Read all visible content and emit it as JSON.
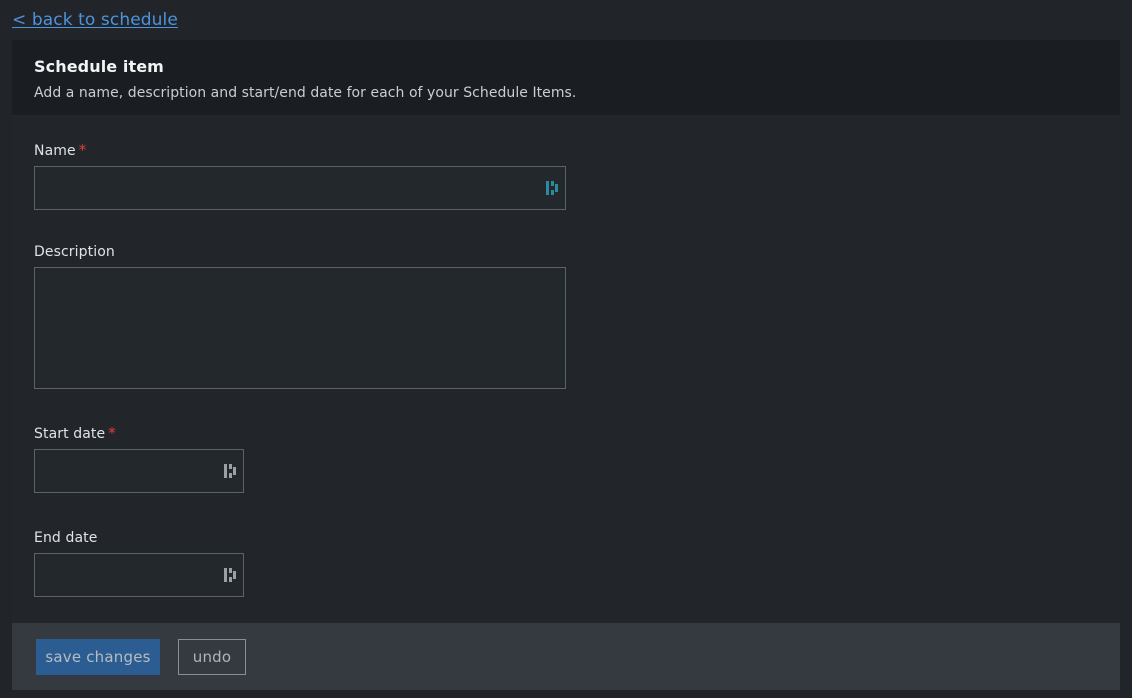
{
  "nav": {
    "back_link": "< back to schedule"
  },
  "card": {
    "title": "Schedule item",
    "subtitle": "Add a name, description and start/end date for each of your Schedule Items."
  },
  "form": {
    "name": {
      "label": "Name",
      "required_marker": "*",
      "value": "",
      "placeholder": ""
    },
    "description": {
      "label": "Description",
      "value": "",
      "placeholder": ""
    },
    "start_date": {
      "label": "Start date",
      "required_marker": "*",
      "value": "",
      "placeholder": ""
    },
    "end_date": {
      "label": "End date",
      "value": "",
      "placeholder": ""
    }
  },
  "footer": {
    "save_label": "save changes",
    "undo_label": "undo"
  },
  "colors": {
    "page_background": "#212529",
    "card_background": "#22262b",
    "header_background": "#1a1d21",
    "footer_background": "#343a40",
    "link": "#4d93dd",
    "required_asterisk": "#e03e3e",
    "primary_button": "#2b5d93",
    "input_border": "#5b6369",
    "accent_glyph": "#2a8a9e"
  }
}
